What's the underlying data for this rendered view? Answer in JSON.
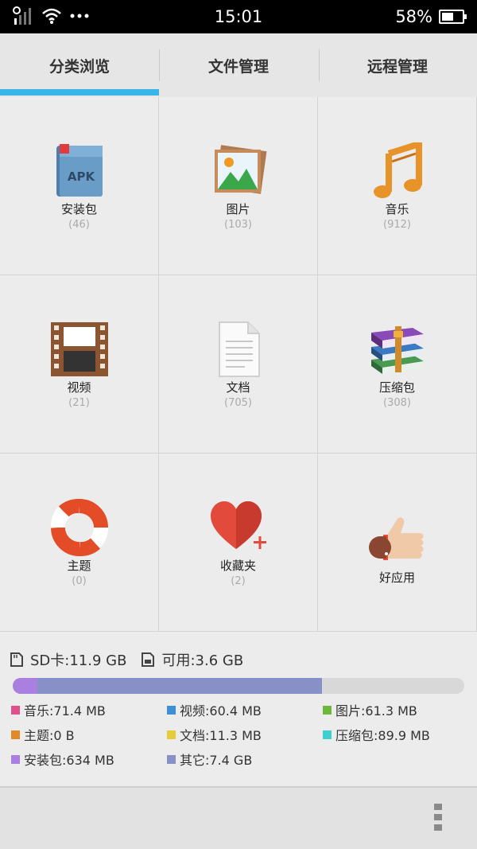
{
  "status_bar": {
    "time": "15:01",
    "battery_percent_text": "58%",
    "battery_level": 0.58,
    "icons": [
      "signal-icon",
      "wifi-icon",
      "more-dots-icon",
      "battery-icon"
    ]
  },
  "tabs": [
    {
      "label": "分类浏览",
      "active": true
    },
    {
      "label": "文件管理",
      "active": false
    },
    {
      "label": "远程管理",
      "active": false
    }
  ],
  "accent_color": "#3ab5e8",
  "categories": [
    {
      "label": "安装包",
      "count": "(46)",
      "icon": "apk-icon"
    },
    {
      "label": "图片",
      "count": "(103)",
      "icon": "picture-icon"
    },
    {
      "label": "音乐",
      "count": "(912)",
      "icon": "music-note-icon"
    },
    {
      "label": "视频",
      "count": "(21)",
      "icon": "film-strip-icon"
    },
    {
      "label": "文档",
      "count": "(705)",
      "icon": "document-icon"
    },
    {
      "label": "压缩包",
      "count": "(308)",
      "icon": "books-archive-icon"
    },
    {
      "label": "主题",
      "count": "(0)",
      "icon": "lifebuoy-icon"
    },
    {
      "label": "收藏夹",
      "count": "(2)",
      "icon": "heart-plus-icon"
    },
    {
      "label": "好应用",
      "count": "",
      "icon": "thumbs-up-icon"
    }
  ],
  "storage": {
    "sd_label": "SD卡:11.9 GB",
    "available_label": "可用:3.6 GB",
    "usage_bar": [
      {
        "name": "安装包",
        "fraction": 0.055,
        "color": "#a97fe0"
      },
      {
        "name": "其它",
        "fraction": 0.63,
        "color": "#8791c8"
      }
    ],
    "legend": [
      {
        "label": "音乐:71.4 MB",
        "color": "#e0508a"
      },
      {
        "label": "视频:60.4 MB",
        "color": "#3d8fd6"
      },
      {
        "label": "图片:61.3 MB",
        "color": "#6db83a"
      },
      {
        "label": "主题:0 B",
        "color": "#e08a2a"
      },
      {
        "label": "文档:11.3 MB",
        "color": "#e5cc3a"
      },
      {
        "label": "压缩包:89.9 MB",
        "color": "#3ed0d0"
      },
      {
        "label": "安装包:634 MB",
        "color": "#a97fe0"
      },
      {
        "label": "其它:7.4 GB",
        "color": "#8791c8"
      }
    ]
  },
  "bottom_bar": {
    "icon": "overflow-menu-icon"
  }
}
